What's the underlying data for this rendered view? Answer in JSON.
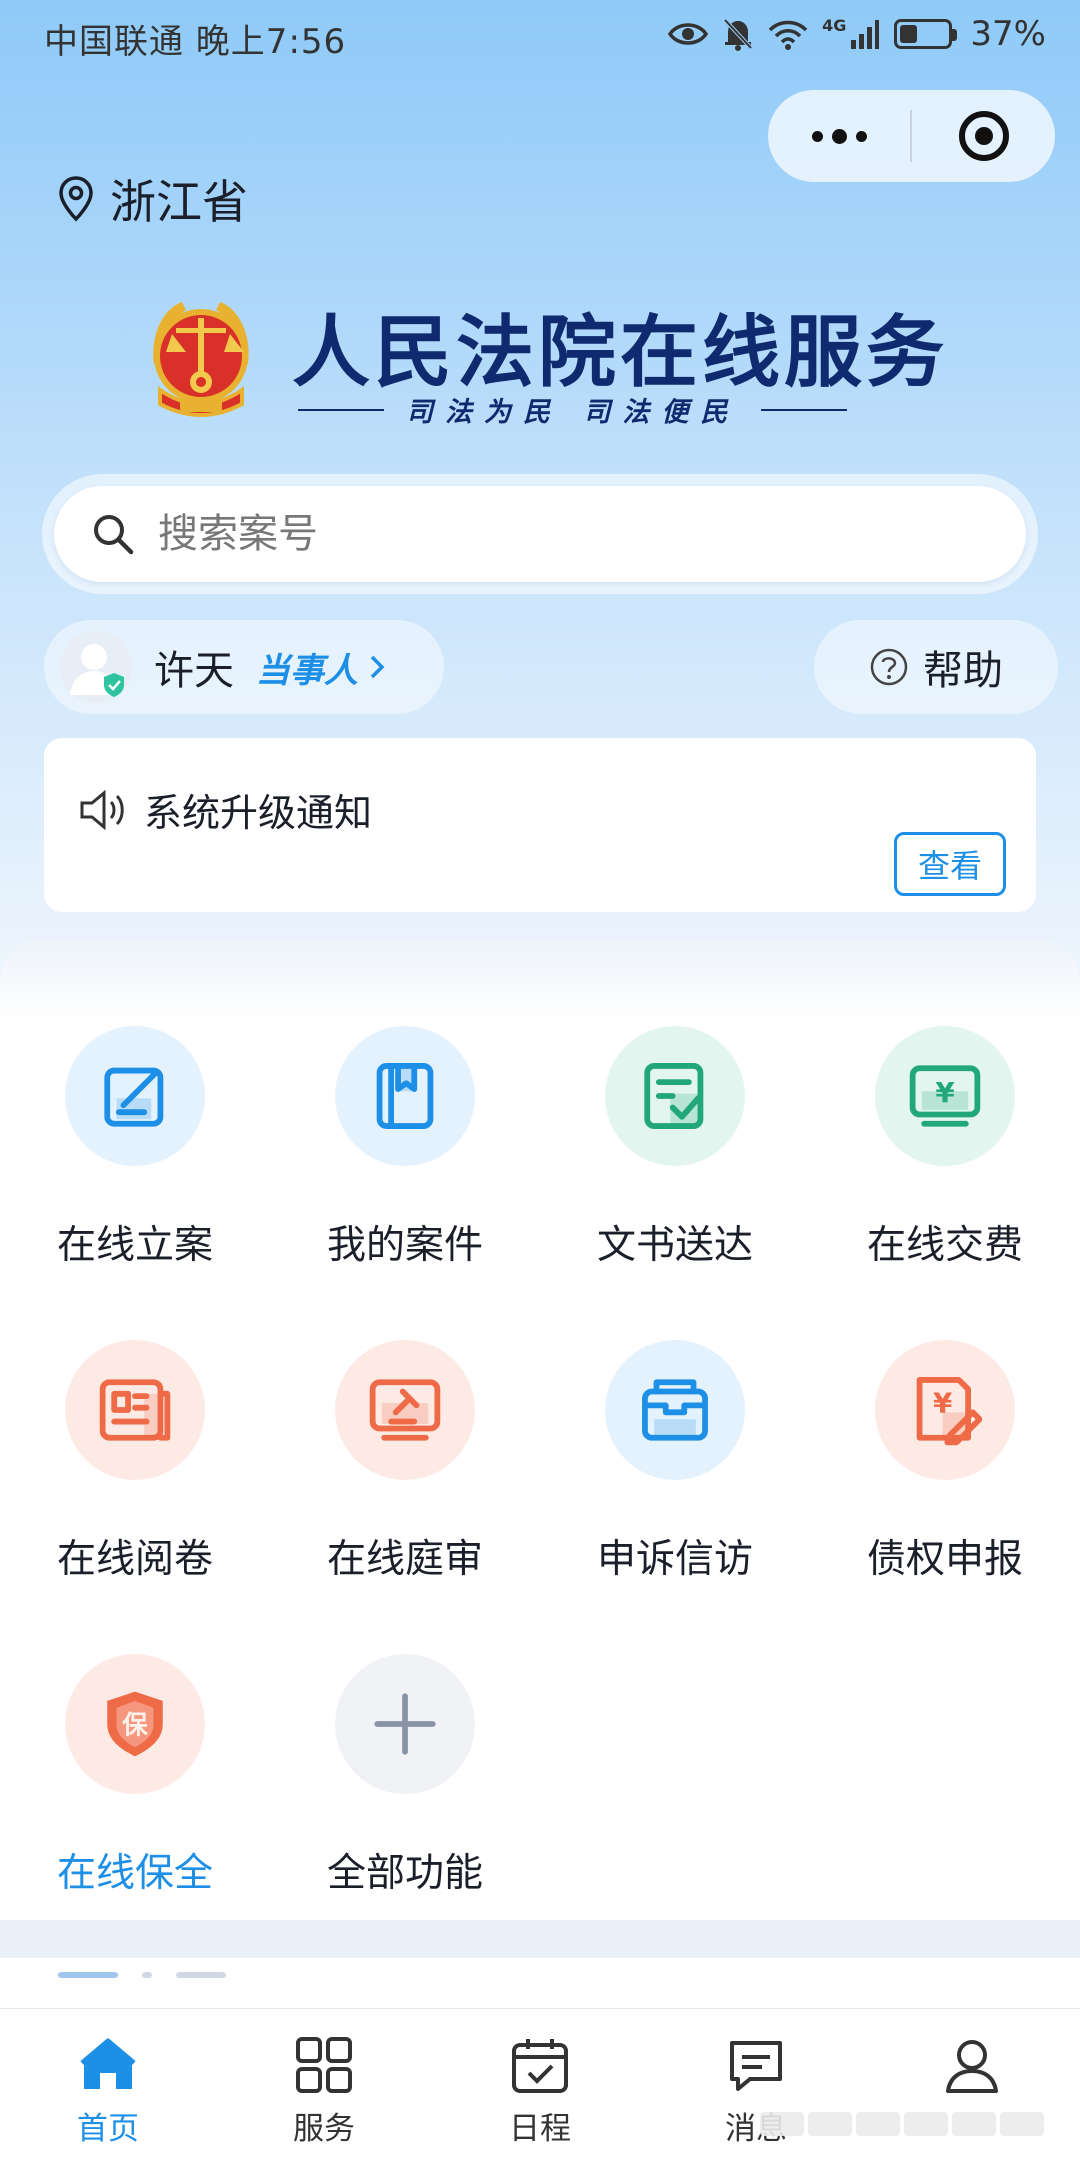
{
  "status_bar": {
    "carrier_time": "中国联通 晚上7:56",
    "network": "4G",
    "battery_percent": 37,
    "battery_text": "37%",
    "icons": [
      "eye-icon",
      "bell-off-icon",
      "wifi-icon",
      "signal-icon",
      "battery-icon"
    ]
  },
  "location": {
    "text": "浙江省",
    "icon": "location-pin-icon"
  },
  "header": {
    "title": "人民法院在线服务",
    "slogan": "司法为民  司法便民",
    "emblem": "court-emblem-logo"
  },
  "search": {
    "placeholder": "搜索案号",
    "icon": "search-icon"
  },
  "user": {
    "name": "许天",
    "role": "当事人",
    "icon": "avatar-icon"
  },
  "help": {
    "label": "帮助",
    "icon": "question-circle-icon"
  },
  "notice": {
    "text": "系统升级通知",
    "button": "查看",
    "icon": "speaker-icon"
  },
  "features": [
    {
      "label": "在线立案",
      "icon": "edit-form-icon",
      "color": "#1e8fe6",
      "bg": "#e3f2fd",
      "active": false
    },
    {
      "label": "我的案件",
      "icon": "case-book-icon",
      "color": "#1e8fe6",
      "bg": "#e3f2fd",
      "active": false
    },
    {
      "label": "文书送达",
      "icon": "document-check-icon",
      "color": "#22a77a",
      "bg": "#e2f5ee",
      "active": false
    },
    {
      "label": "在线交费",
      "icon": "payment-monitor-icon",
      "color": "#22a77a",
      "bg": "#e2f5ee",
      "active": false
    },
    {
      "label": "在线阅卷",
      "icon": "newspaper-icon",
      "color": "#ef6a47",
      "bg": "#fdeae5",
      "active": false
    },
    {
      "label": "在线庭审",
      "icon": "gavel-screen-icon",
      "color": "#ef6a47",
      "bg": "#fdeae5",
      "active": false
    },
    {
      "label": "申诉信访",
      "icon": "mailbox-icon",
      "color": "#1e8fe6",
      "bg": "#e3f2fd",
      "active": false
    },
    {
      "label": "债权申报",
      "icon": "yuan-document-icon",
      "color": "#ef6a47",
      "bg": "#fdeae5",
      "active": false
    },
    {
      "label": "在线保全",
      "icon": "shield-bao-icon",
      "color": "#ef6a47",
      "bg": "#fdeae5",
      "active": true
    },
    {
      "label": "全部功能",
      "icon": "plus-icon",
      "color": "#8a93a6",
      "bg": "#f0f2f6",
      "active": false
    }
  ],
  "tabbar": [
    {
      "label": "首页",
      "icon": "home-icon",
      "active": true
    },
    {
      "label": "服务",
      "icon": "grid-icon",
      "active": false
    },
    {
      "label": "日程",
      "icon": "calendar-check-icon",
      "active": false
    },
    {
      "label": "消息",
      "icon": "message-icon",
      "active": false
    },
    {
      "label": "",
      "icon": "profile-icon",
      "active": false
    }
  ],
  "colors": {
    "accent": "#1e8fe6",
    "title": "#0f2a6e"
  }
}
